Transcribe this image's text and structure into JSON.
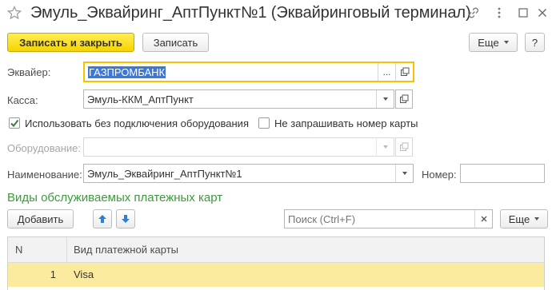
{
  "window": {
    "title": "Эмуль_Эквайринг_АптПункт№1 (Эквайринговый терминал)"
  },
  "toolbar": {
    "save_close_label": "Записать и закрыть",
    "save_label": "Записать",
    "more_label": "Еще",
    "help_label": "?"
  },
  "form": {
    "acquirer": {
      "label": "Эквайер:",
      "value": "ГАЗПРОМБАНК"
    },
    "cashbox": {
      "label": "Касса:",
      "value": "Эмуль-ККМ_АптПункт"
    },
    "use_without_equipment": {
      "label": "Использовать без подключения оборудования",
      "checked": true
    },
    "no_card_number": {
      "label": "Не запрашивать номер карты",
      "checked": false
    },
    "equipment": {
      "label": "Оборудование:",
      "value": ""
    },
    "name": {
      "label": "Наименование:",
      "value": "Эмуль_Эквайринг_АптПункт№1"
    },
    "number": {
      "label": "Номер:",
      "value": ""
    }
  },
  "cards_section": {
    "title": "Виды обслуживаемых платежных карт",
    "add_label": "Добавить",
    "search_placeholder": "Поиск (Ctrl+F)",
    "more_label": "Еще",
    "columns": [
      "N",
      "Вид платежной карты"
    ],
    "rows": [
      {
        "n": "1",
        "card_type": "Visa"
      }
    ]
  }
}
